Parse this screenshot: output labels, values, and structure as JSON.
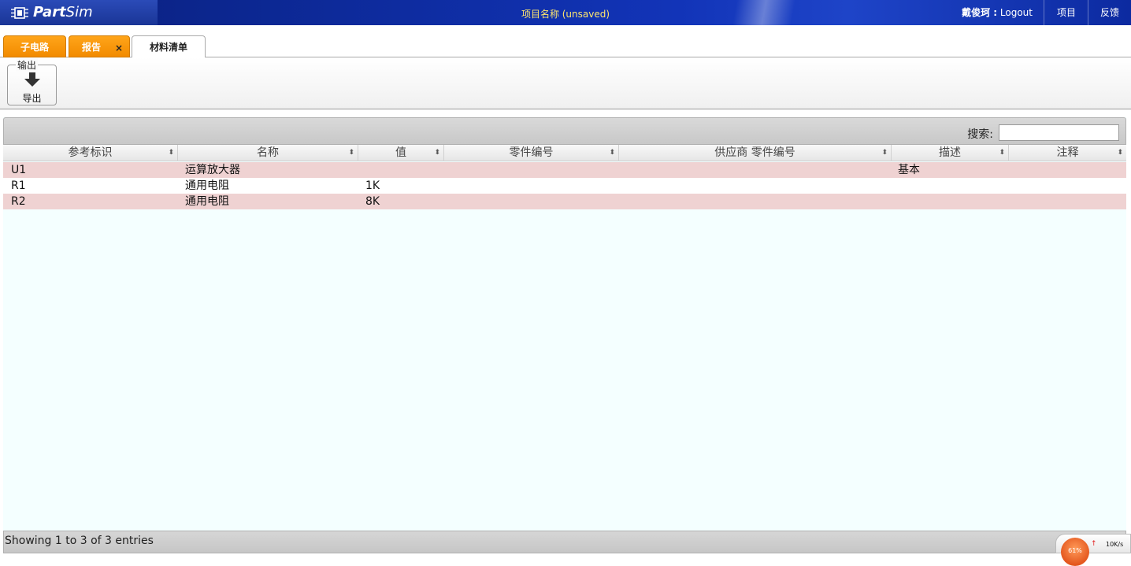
{
  "app": {
    "logo_text_bold": "Part",
    "logo_text_rest": "Sim",
    "project_title": "项目名称 (unsaved)",
    "user_name": "戴俊珂 :",
    "logout_label": "Logout",
    "nav_project": "项目",
    "nav_feedback": "反馈"
  },
  "tabs": [
    {
      "label": "子电路"
    },
    {
      "label": "报告",
      "close_glyph": "×"
    },
    {
      "label": "材料清单"
    }
  ],
  "toolbar": {
    "group_label": "输出",
    "export_label": "导出"
  },
  "search": {
    "label": "搜索:",
    "value": ""
  },
  "table": {
    "columns": [
      "参考标识",
      "名称",
      "值",
      "零件编号",
      "供应商 零件编号",
      "描述",
      "注释"
    ],
    "sort_glyph": "⬍",
    "rows": [
      [
        "U1",
        "运算放大器",
        "",
        "",
        "",
        "基本",
        ""
      ],
      [
        "R1",
        "通用电阻",
        "1K",
        "",
        "",
        "",
        ""
      ],
      [
        "R2",
        "通用电阻",
        "8K",
        "",
        "",
        "",
        ""
      ]
    ]
  },
  "footer": {
    "info": "Showing 1 to 3 of 3 entries"
  },
  "net_widget": {
    "percent": "61%",
    "speed": "10K/s",
    "arrow": "↑"
  }
}
